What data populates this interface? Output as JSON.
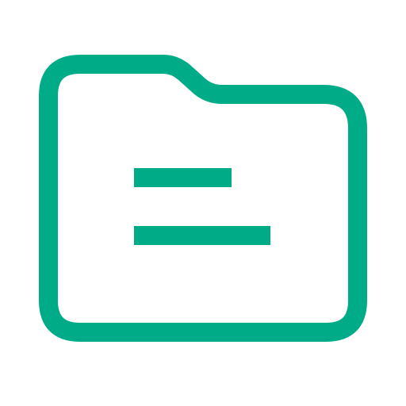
{
  "icon": {
    "name": "folder-document-icon",
    "stroke_color": "#00AB87",
    "background_color": "#FFFFFF",
    "lines": [
      {
        "name": "short-text-line"
      },
      {
        "name": "long-text-line"
      }
    ]
  }
}
